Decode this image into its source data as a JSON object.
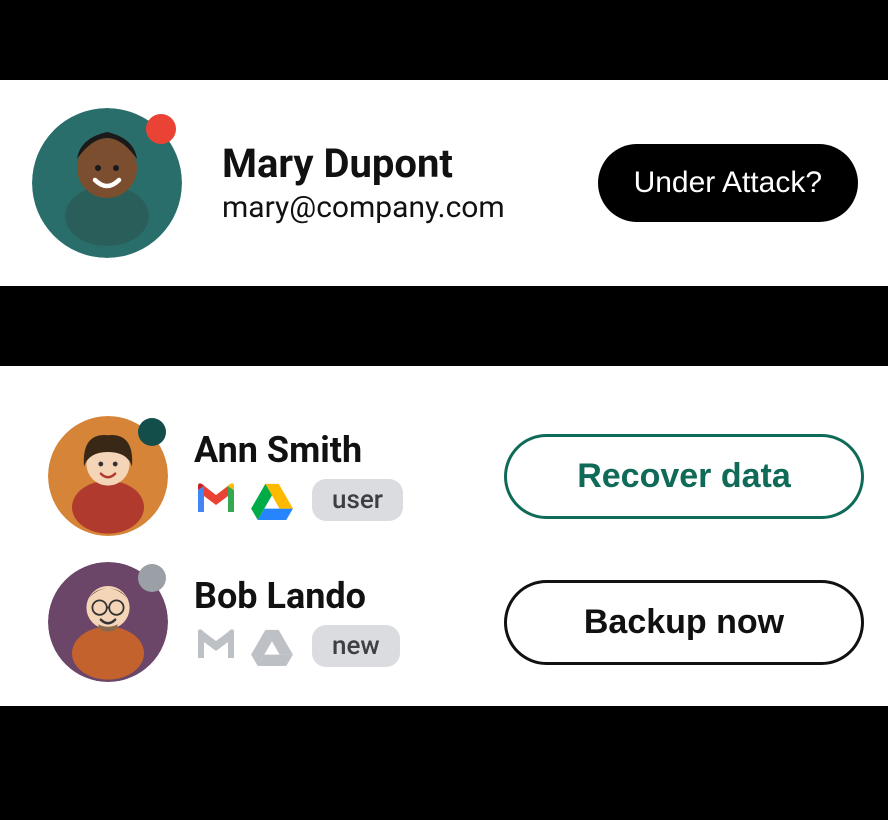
{
  "topCard": {
    "user": {
      "name": "Mary Dupont",
      "email": "mary@company.com",
      "statusColor": "#ea4335"
    },
    "actionLabel": "Under Attack?"
  },
  "bottomCard": {
    "rows": [
      {
        "name": "Ann Smith",
        "badge": "user",
        "statusColor": "#134e4a",
        "iconsActive": true,
        "actionLabel": "Recover data",
        "actionStyle": "teal"
      },
      {
        "name": "Bob Lando",
        "badge": "new",
        "statusColor": "#9aa0a6",
        "iconsActive": false,
        "actionLabel": "Backup now",
        "actionStyle": "black"
      }
    ]
  }
}
